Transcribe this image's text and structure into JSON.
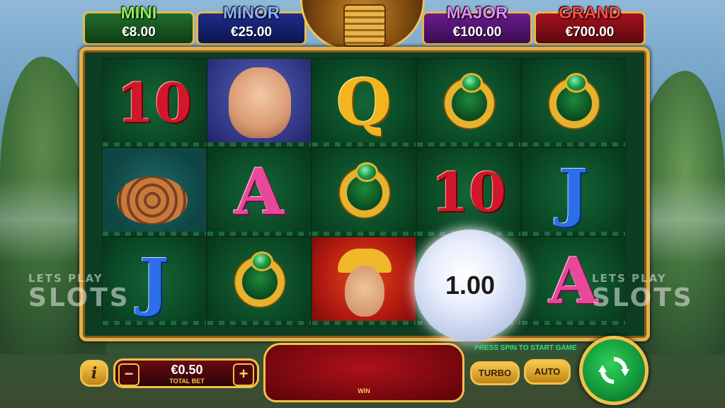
{
  "jackpots": {
    "mini": {
      "label": "MINI",
      "value": "€8.00",
      "color": "#8bf05a"
    },
    "minor": {
      "label": "MINOR",
      "value": "€25.00",
      "color": "#8ab0ff"
    },
    "major": {
      "label": "MAJOR",
      "value": "€100.00",
      "color": "#e08aff"
    },
    "grand": {
      "label": "GRAND",
      "value": "€700.00",
      "color": "#ff4a4a"
    }
  },
  "watermark": {
    "line1": "LETS PLAY",
    "line2": "SLOTS"
  },
  "reels": [
    [
      "10",
      "puma",
      "Q",
      "ring",
      "ring"
    ],
    [
      "snake",
      "A",
      "ring",
      "10",
      "J"
    ],
    [
      "J",
      "ring",
      "priestess",
      "moon",
      "A"
    ]
  ],
  "moon_value": "1.00",
  "controls": {
    "info_label": "i",
    "minus_label": "−",
    "plus_label": "+",
    "total_bet_value": "€0.50",
    "total_bet_label": "TOTAL BET",
    "win_label": "WIN",
    "press_spin_text": "PRESS SPIN TO START GAME",
    "turbo_label": "TURBO",
    "auto_label": "AUTO"
  }
}
